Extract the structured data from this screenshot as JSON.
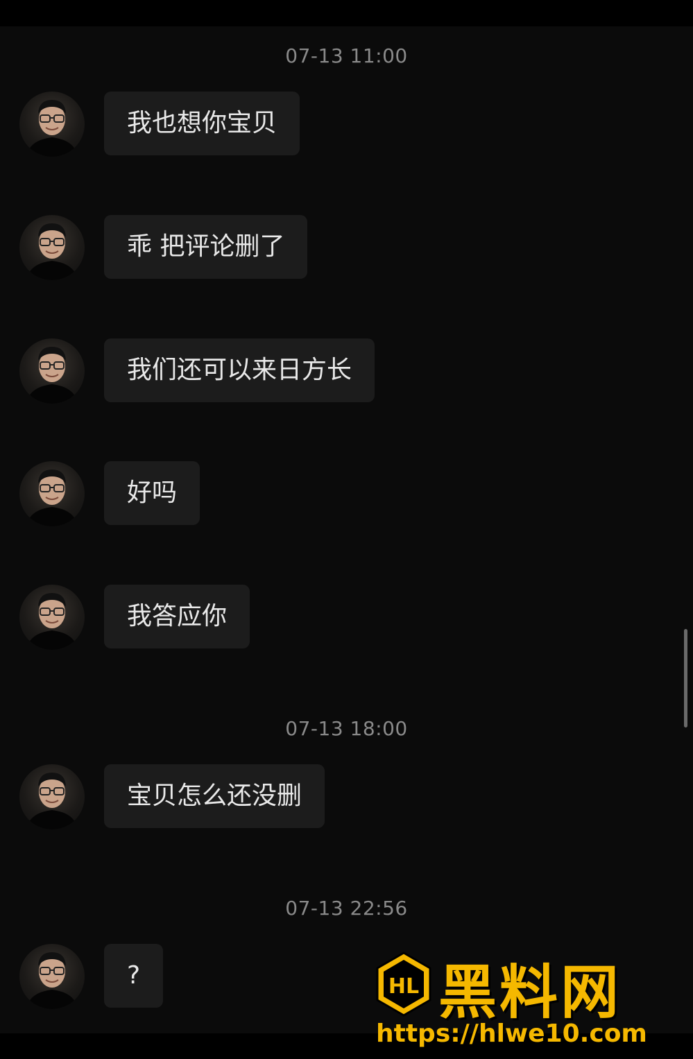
{
  "chat": {
    "timestamps": [
      "07-13 11:00",
      "07-13 18:00",
      "07-13 22:56"
    ],
    "messages": [
      {
        "text": "我也想你宝贝"
      },
      {
        "text": "乖 把评论删了"
      },
      {
        "text": "我们还可以来日方长"
      },
      {
        "text": "好吗"
      },
      {
        "text": "我答应你"
      },
      {
        "text": "宝贝怎么还没删"
      },
      {
        "text": "?"
      }
    ]
  },
  "watermark": {
    "title": "黑料网",
    "url": "https://hlwe10.com",
    "logo_letters": "HL",
    "color": "#f5b800"
  },
  "colors": {
    "background": "#0b0b0b",
    "bubble": "#1c1c1c",
    "bubble_text": "#e9e9e9",
    "timestamp_text": "#8a8a8a"
  }
}
